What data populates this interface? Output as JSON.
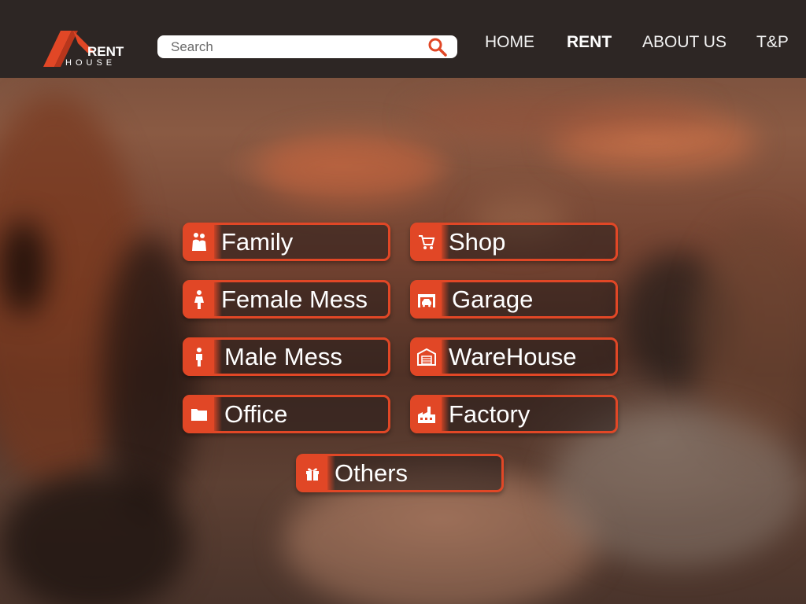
{
  "header": {
    "logo": {
      "text_top": "RENT",
      "text_bottom": "HOUSE",
      "icon": "house-roof-logo"
    },
    "search": {
      "placeholder": "Search",
      "value": "",
      "icon": "search-icon"
    },
    "nav": [
      {
        "label": "HOME",
        "active": false
      },
      {
        "label": "RENT",
        "active": true
      },
      {
        "label": "ABOUT US",
        "active": false
      },
      {
        "label": "T&P",
        "active": false
      }
    ]
  },
  "categories": [
    {
      "label": "Family",
      "icon": "family-icon"
    },
    {
      "label": "Shop",
      "icon": "cart-icon"
    },
    {
      "label": "Female Mess",
      "icon": "female-icon"
    },
    {
      "label": "Garage",
      "icon": "garage-icon"
    },
    {
      "label": "Male Mess",
      "icon": "male-icon"
    },
    {
      "label": "WareHouse",
      "icon": "warehouse-icon"
    },
    {
      "label": "Office",
      "icon": "folder-icon"
    },
    {
      "label": "Factory",
      "icon": "factory-icon"
    },
    {
      "label": "Others",
      "icon": "gift-icon"
    }
  ],
  "colors": {
    "accent": "#e14726",
    "topbar": "#2d2624",
    "text": "#ffffff"
  }
}
